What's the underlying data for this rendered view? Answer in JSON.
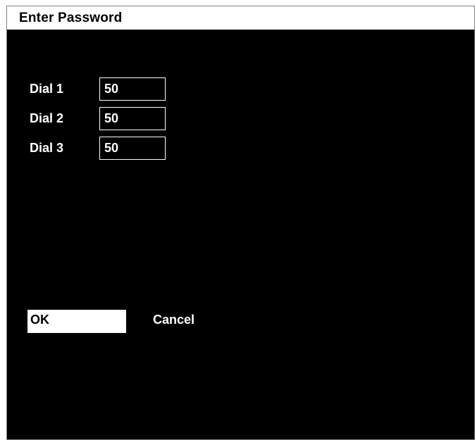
{
  "dialog": {
    "title": "Enter Password"
  },
  "dials": [
    {
      "label": "Dial 1",
      "value": "50"
    },
    {
      "label": "Dial 2",
      "value": "50"
    },
    {
      "label": "Dial 3",
      "value": "50"
    }
  ],
  "buttons": {
    "ok_label": "OK",
    "cancel_label": "Cancel"
  },
  "colors": {
    "background": "#000000",
    "foreground": "#ffffff",
    "title_bar": "#ffffff",
    "selected_button": "#ffffff"
  }
}
